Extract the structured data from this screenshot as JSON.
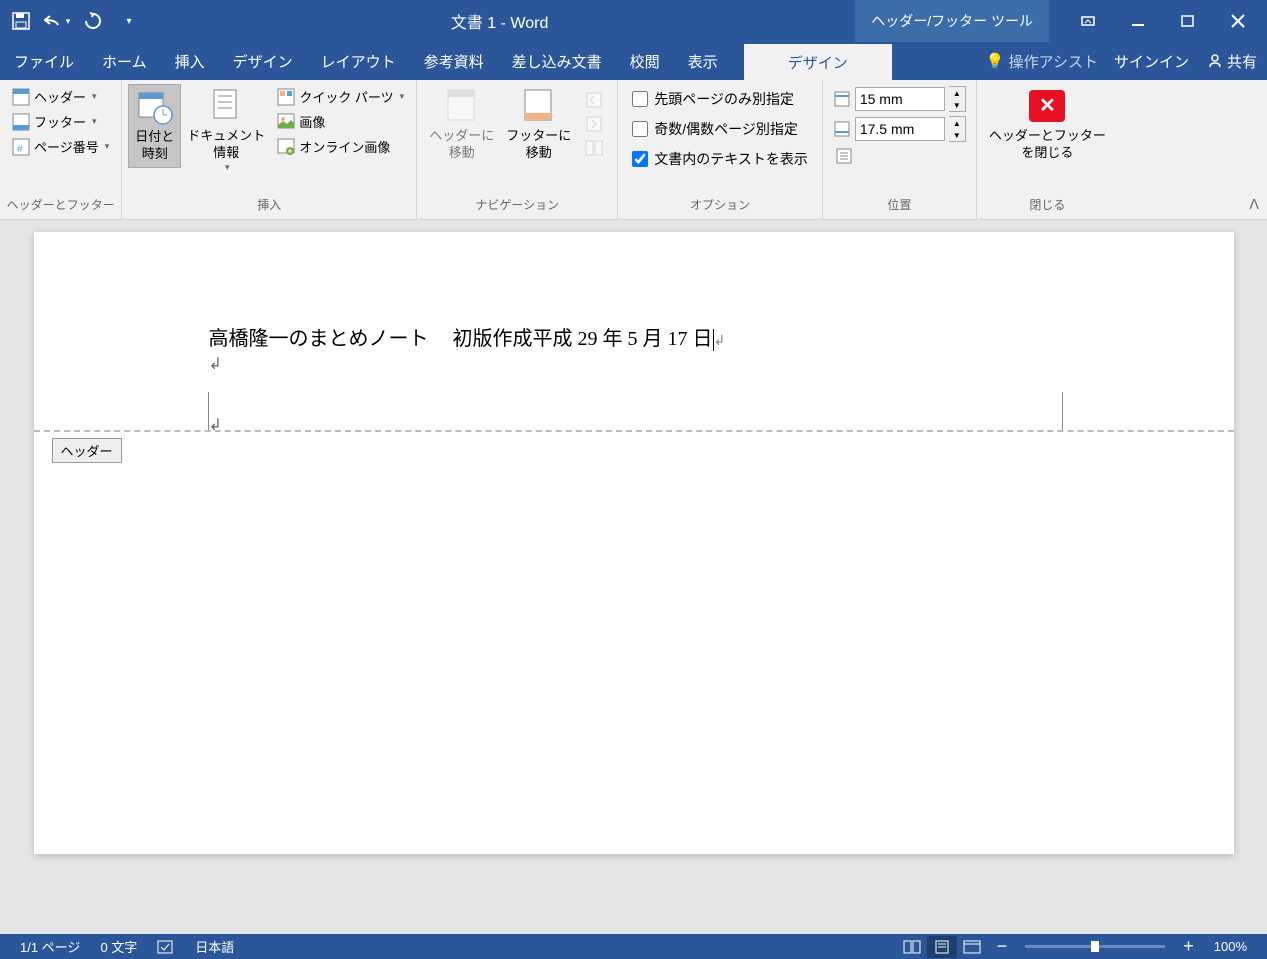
{
  "title": "文書 1 - Word",
  "contextualTab": "ヘッダー/フッター ツール",
  "tabs": {
    "file": "ファイル",
    "home": "ホーム",
    "insert": "挿入",
    "design": "デザイン",
    "layout": "レイアウト",
    "references": "参考資料",
    "mailings": "差し込み文書",
    "review": "校閲",
    "view": "表示",
    "contextDesign": "デザイン"
  },
  "tellMe": "操作アシスト",
  "signIn": "サインイン",
  "share": "共有",
  "groups": {
    "headerFooter": {
      "label": "ヘッダーとフッター",
      "header": "ヘッダー",
      "footer": "フッター",
      "pageNumber": "ページ番号"
    },
    "insert": {
      "label": "挿入",
      "dateTime": "日付と\n時刻",
      "documentInfo": "ドキュメント\n情報",
      "quickParts": "クイック パーツ",
      "pictures": "画像",
      "onlinePictures": "オンライン画像"
    },
    "navigation": {
      "label": "ナビゲーション",
      "goToHeader": "ヘッダーに\n移動",
      "goToFooter": "フッターに\n移動"
    },
    "options": {
      "label": "オプション",
      "diffFirst": "先頭ページのみ別指定",
      "diffOddEven": "奇数/偶数ページ別指定",
      "showText": "文書内のテキストを表示"
    },
    "position": {
      "label": "位置",
      "topValue": "15 mm",
      "bottomValue": "17.5 mm"
    },
    "close": {
      "label": "閉じる",
      "closeBtn": "ヘッダーとフッター\nを閉じる"
    }
  },
  "doc": {
    "headerLine1a": "高橋隆一のまとめノート",
    "headerLine1b": "初版作成平成 29 年 5 月 17 日",
    "headerTabLabel": "ヘッダー"
  },
  "status": {
    "page": "1/1 ページ",
    "words": "0 文字",
    "language": "日本語",
    "zoom": "100%"
  }
}
